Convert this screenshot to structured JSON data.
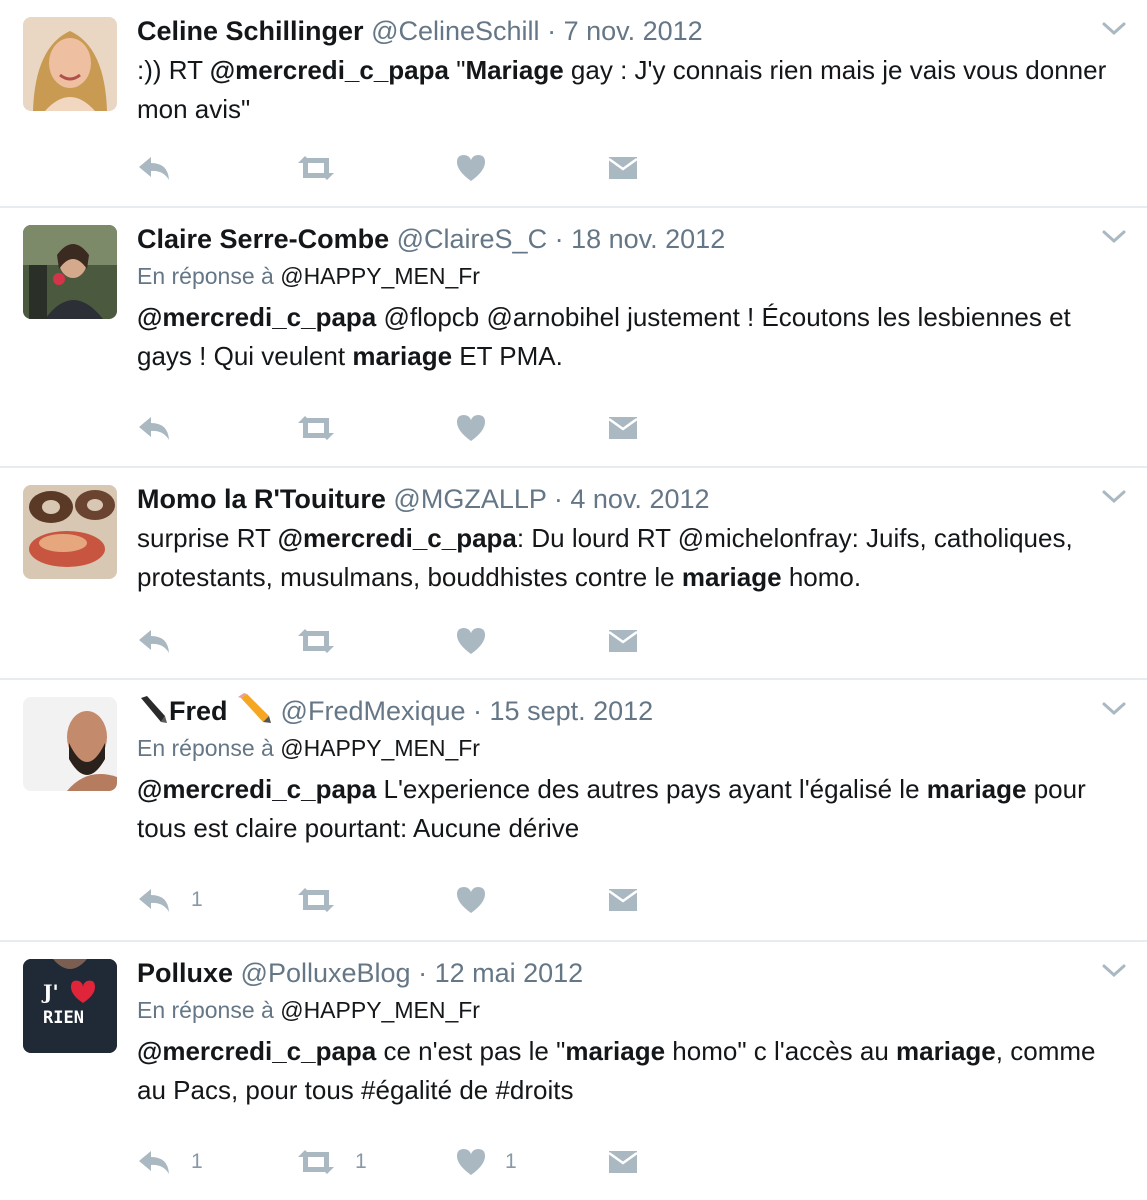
{
  "tweets": [
    {
      "name": "Celine Schillinger",
      "handle": "@CelineSchill",
      "separator": " · ",
      "date": "7 nov. 2012",
      "reply_prefix": "",
      "reply_user": "",
      "text": [
        {
          "t": ":)) RT ",
          "b": false
        },
        {
          "t": "@mercredi_c_papa",
          "b": true
        },
        {
          "t": " \"",
          "b": false
        },
        {
          "t": "Mariage",
          "b": true
        },
        {
          "t": " gay : J'y connais rien mais je vais vous donner mon avis\"",
          "b": false
        }
      ],
      "counts": {
        "reply": "",
        "retweet": "",
        "like": ""
      }
    },
    {
      "name": "Claire Serre-Combe",
      "handle": "@ClaireS_C",
      "separator": " · ",
      "date": "18 nov. 2012",
      "reply_prefix": "En réponse à ",
      "reply_user": "@HAPPY_MEN_Fr",
      "text": [
        {
          "t": "@mercredi_c_papa",
          "b": true
        },
        {
          "t": " @flopcb @arnobihel justement ! Écoutons les lesbiennes et gays ! Qui veulent ",
          "b": false
        },
        {
          "t": "mariage",
          "b": true
        },
        {
          "t": " ET PMA.",
          "b": false
        }
      ],
      "counts": {
        "reply": "",
        "retweet": "",
        "like": ""
      }
    },
    {
      "name": "Momo la R'Touiture",
      "handle": "@MGZALLP",
      "separator": " · ",
      "date": "4 nov. 2012",
      "reply_prefix": "",
      "reply_user": "",
      "text": [
        {
          "t": "surprise RT ",
          "b": false
        },
        {
          "t": "@mercredi_c_papa",
          "b": true
        },
        {
          "t": ": Du lourd RT @michelonfray: Juifs, catholiques, protestants, musulmans, bouddhistes contre le ",
          "b": false
        },
        {
          "t": "mariage",
          "b": true
        },
        {
          "t": " homo.",
          "b": false
        }
      ],
      "counts": {
        "reply": "",
        "retweet": "",
        "like": ""
      }
    },
    {
      "name": "Fred",
      "handle": "@FredMexique",
      "separator": " · ",
      "date": "15 sept. 2012",
      "reply_prefix": "En réponse à ",
      "reply_user": "@HAPPY_MEN_Fr",
      "text": [
        {
          "t": "@mercredi_c_papa",
          "b": true
        },
        {
          "t": " L'experience des autres pays ayant l'égalisé le ",
          "b": false
        },
        {
          "t": "mariage",
          "b": true
        },
        {
          "t": " pour tous est claire pourtant: Aucune dérive",
          "b": false
        }
      ],
      "counts": {
        "reply": "1",
        "retweet": "",
        "like": ""
      }
    },
    {
      "name": "Polluxe",
      "handle": "@PolluxeBlog",
      "separator": " · ",
      "date": "12 mai 2012",
      "reply_prefix": "En réponse à ",
      "reply_user": "@HAPPY_MEN_Fr",
      "text": [
        {
          "t": "@mercredi_c_papa",
          "b": true
        },
        {
          "t": " ce n'est pas le \"",
          "b": false
        },
        {
          "t": "mariage",
          "b": true
        },
        {
          "t": " homo\" c l'accès au ",
          "b": false
        },
        {
          "t": "mariage",
          "b": true
        },
        {
          "t": ", comme au Pacs, pour tous #égalité de #droits",
          "b": false
        }
      ],
      "counts": {
        "reply": "1",
        "retweet": "1",
        "like": "1"
      }
    }
  ],
  "avatar_text": {
    "polluxe_line1": "J'",
    "polluxe_line2": "RIEN"
  },
  "colors": {
    "name": "#14171a",
    "meta": "#657786",
    "icon": "#aab8c2",
    "divider": "#e6ecf0"
  }
}
